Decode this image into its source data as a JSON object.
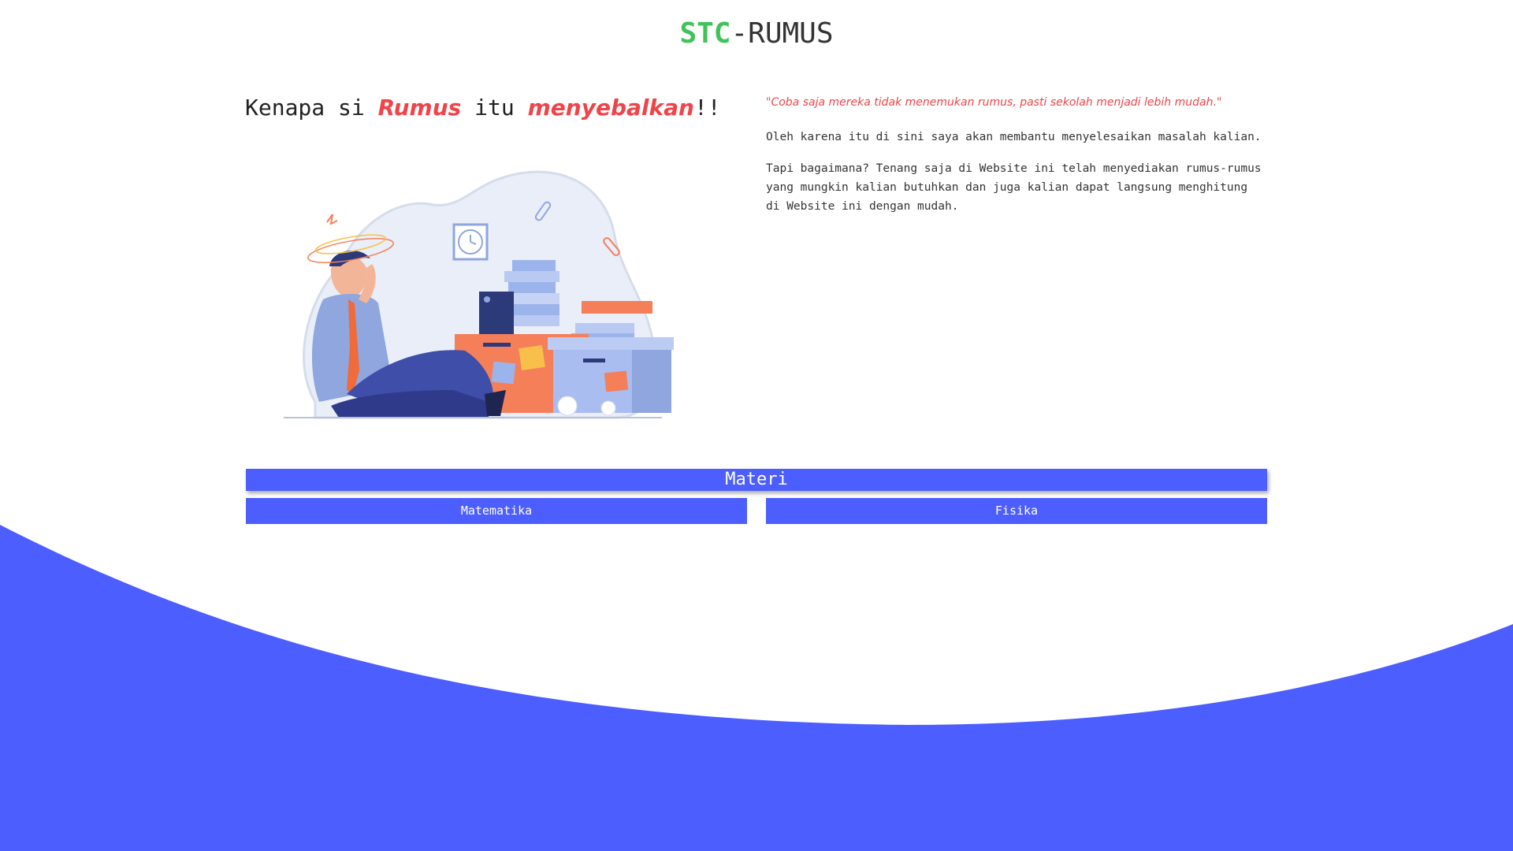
{
  "colors": {
    "accent_green": "#3fc35a",
    "primary_blue": "#4d5efe",
    "highlight_red": "#f0444a"
  },
  "logo": {
    "accent": "STC",
    "rest": "-RUMUS"
  },
  "hero": {
    "headline_part1": "Kenapa si ",
    "headline_highlight1": "Rumus",
    "headline_part2": " itu ",
    "headline_highlight2": "menyebalkan",
    "headline_part3": "!!",
    "illustration_icon": "stressed-person-illustration"
  },
  "intro": {
    "quote": "\"Coba saja mereka tidak menemukan rumus, pasti sekolah menjadi lebih mudah.\"",
    "paragraph1": "Oleh karena itu di sini saya akan membantu menyelesaikan masalah kalian.",
    "paragraph2": "Tapi bagaimana? Tenang saja di Website ini telah menyediakan rumus-rumus yang mungkin kalian butuhkan dan juga kalian dapat langsung menghitung di Website ini dengan mudah."
  },
  "materi": {
    "title": "Materi",
    "buttons": [
      {
        "label": "Matematika"
      },
      {
        "label": "Fisika"
      }
    ]
  }
}
